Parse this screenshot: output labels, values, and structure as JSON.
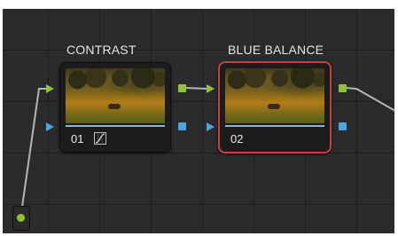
{
  "nodes": [
    {
      "title": "CONTRAST",
      "number": "01",
      "icon": "curves-icon",
      "selected": false
    },
    {
      "title": "BLUE BALANCE",
      "number": "02",
      "icon": "",
      "selected": true
    }
  ],
  "colors": {
    "rgb_port": "#8fc43a",
    "key_port": "#4aa7e0",
    "selection": "#c0433a",
    "wire": "#b5b5b5"
  }
}
